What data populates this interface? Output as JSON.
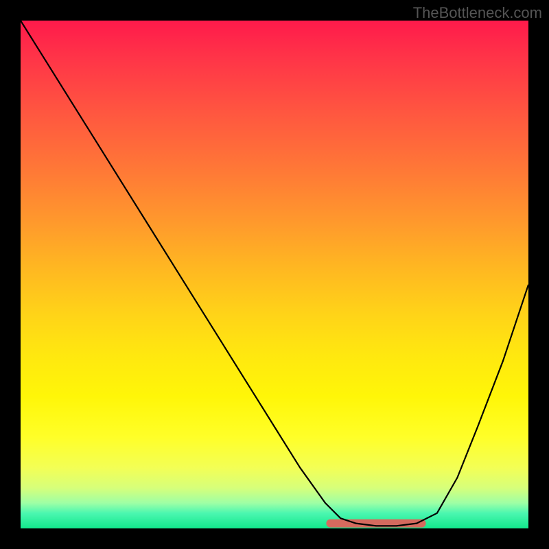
{
  "watermark": "TheBottleneck.com",
  "chart_data": {
    "type": "line",
    "title": "",
    "xlabel": "",
    "ylabel": "",
    "xlim": [
      0,
      100
    ],
    "ylim": [
      0,
      100
    ],
    "grid": false,
    "legend": false,
    "series": [
      {
        "name": "bottleneck-curve",
        "x": [
          0,
          5,
          10,
          15,
          20,
          25,
          30,
          35,
          40,
          45,
          50,
          55,
          60,
          63,
          66,
          70,
          74,
          78,
          82,
          86,
          90,
          95,
          100
        ],
        "y": [
          100,
          92,
          84,
          76,
          68,
          60,
          52,
          44,
          36,
          28,
          20,
          12,
          5,
          2,
          1,
          0.5,
          0.5,
          1,
          3,
          10,
          20,
          33,
          48
        ]
      }
    ],
    "highlight_segment": {
      "name": "minimum-plateau",
      "x_start": 61,
      "x_end": 79,
      "y": 0.6
    }
  }
}
